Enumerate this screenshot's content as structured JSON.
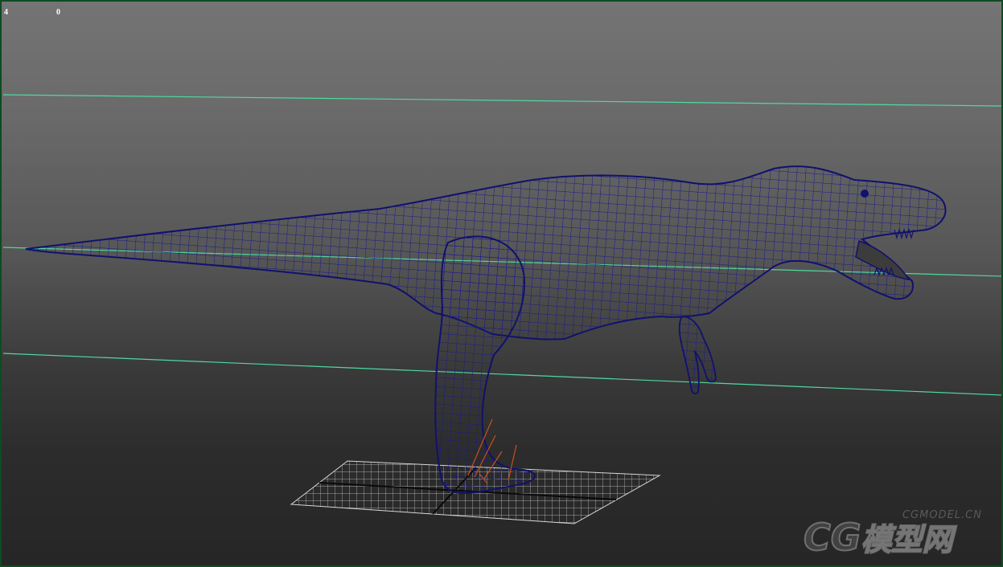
{
  "viewport": {
    "hud_left_value": "4",
    "hud_right_value": "0"
  },
  "scene": {
    "subject_icon": "dinosaur-wireframe-icon",
    "mesh_color": "#1a1a8c",
    "guide_line_color": "#4fd9a0",
    "grid_color": "#d0d0d0",
    "border_color": "#0f4a24"
  },
  "watermark": {
    "domain": "CGMODEL.CN",
    "brand_latin": "CG",
    "brand_cn": "模型网"
  }
}
